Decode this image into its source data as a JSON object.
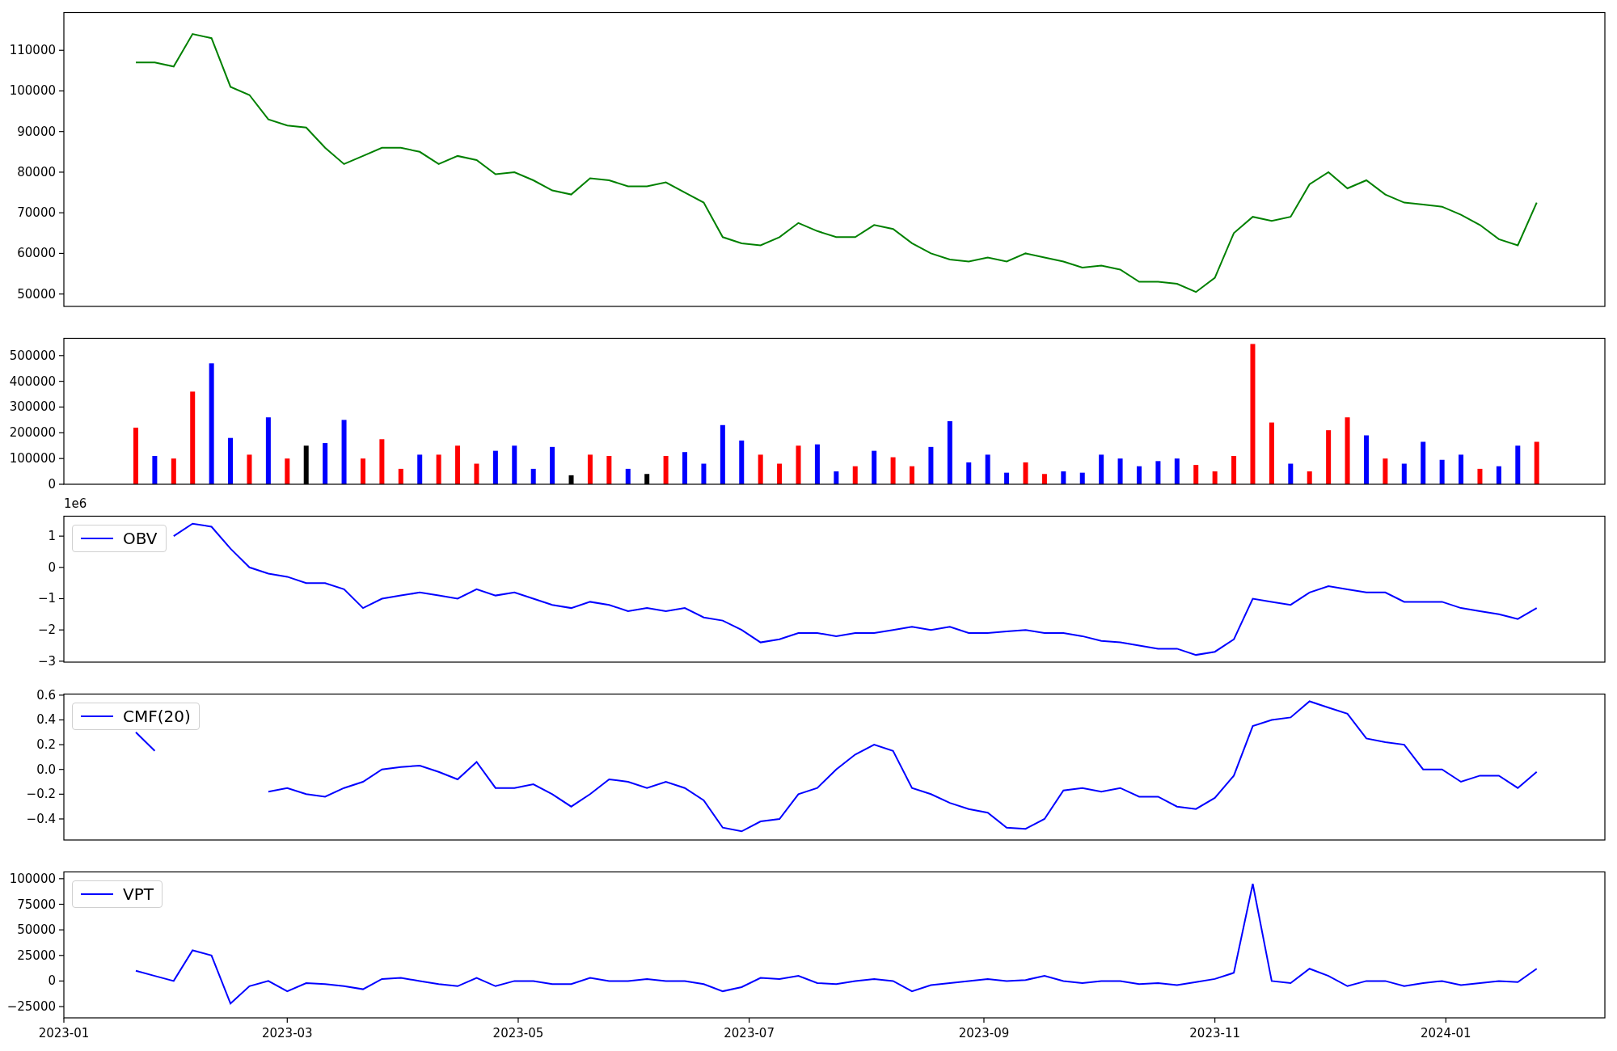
{
  "figure": {
    "panels": [
      {
        "legend": false,
        "chart_data": {
          "type": "line",
          "x": [
            "2023-01-20",
            "2023-01-25",
            "2023-01-30",
            "2023-02-04",
            "2023-02-09",
            "2023-02-14",
            "2023-02-19",
            "2023-02-24",
            "2023-03-01",
            "2023-03-06",
            "2023-03-11",
            "2023-03-16",
            "2023-03-21",
            "2023-03-26",
            "2023-03-31",
            "2023-04-05",
            "2023-04-10",
            "2023-04-15",
            "2023-04-20",
            "2023-04-25",
            "2023-04-30",
            "2023-05-05",
            "2023-05-10",
            "2023-05-15",
            "2023-05-20",
            "2023-05-25",
            "2023-05-30",
            "2023-06-04",
            "2023-06-09",
            "2023-06-14",
            "2023-06-19",
            "2023-06-24",
            "2023-06-29",
            "2023-07-04",
            "2023-07-09",
            "2023-07-14",
            "2023-07-19",
            "2023-07-24",
            "2023-07-29",
            "2023-08-03",
            "2023-08-08",
            "2023-08-13",
            "2023-08-18",
            "2023-08-23",
            "2023-08-28",
            "2023-09-02",
            "2023-09-07",
            "2023-09-12",
            "2023-09-17",
            "2023-09-22",
            "2023-09-27",
            "2023-10-02",
            "2023-10-07",
            "2023-10-12",
            "2023-10-17",
            "2023-10-22",
            "2023-10-27",
            "2023-11-01",
            "2023-11-06",
            "2023-11-11",
            "2023-11-16",
            "2023-11-21",
            "2023-11-26",
            "2023-12-01",
            "2023-12-06",
            "2023-12-11",
            "2023-12-16",
            "2023-12-21",
            "2023-12-26",
            "2023-12-31",
            "2024-01-05",
            "2024-01-10",
            "2024-01-15",
            "2024-01-20",
            "2024-01-25"
          ],
          "series": [
            {
              "color": "#008000",
              "values": [
                107000,
                107000,
                106000,
                114000,
                113000,
                101000,
                99000,
                93000,
                91500,
                91000,
                86000,
                82000,
                84000,
                86000,
                86000,
                85000,
                82000,
                84000,
                83000,
                79500,
                80000,
                78000,
                75500,
                74500,
                78500,
                78000,
                76500,
                76500,
                77500,
                75000,
                72500,
                64000,
                62500,
                62000,
                64000,
                67500,
                65500,
                64000,
                64000,
                67000,
                66000,
                62500,
                60000,
                58500,
                58000,
                59000,
                58000,
                60000,
                59000,
                58000,
                56500,
                57000,
                56000,
                53000,
                53000,
                52500,
                50500,
                54000,
                65000,
                69000,
                68000,
                69000,
                77000,
                80000,
                76000,
                78000,
                74500,
                72500,
                72000,
                71500,
                69500,
                67000,
                63500,
                62000,
                72500
              ]
            }
          ],
          "xlim": [
            "2023-01-01",
            "2024-02-12"
          ],
          "ylim": [
            46950,
            119400
          ],
          "yticks": [
            {
              "value": 50000,
              "label": "50000"
            },
            {
              "value": 60000,
              "label": "60000"
            },
            {
              "value": 70000,
              "label": "70000"
            },
            {
              "value": 80000,
              "label": "80000"
            },
            {
              "value": 90000,
              "label": "90000"
            },
            {
              "value": 100000,
              "label": "100000"
            },
            {
              "value": 110000,
              "label": "110000"
            }
          ]
        }
      },
      {
        "legend": false,
        "chart_data": {
          "type": "bar",
          "x": [
            "2023-01-20",
            "2023-01-25",
            "2023-01-30",
            "2023-02-04",
            "2023-02-09",
            "2023-02-14",
            "2023-02-19",
            "2023-02-24",
            "2023-03-01",
            "2023-03-06",
            "2023-03-11",
            "2023-03-16",
            "2023-03-21",
            "2023-03-26",
            "2023-03-31",
            "2023-04-05",
            "2023-04-10",
            "2023-04-15",
            "2023-04-20",
            "2023-04-25",
            "2023-04-30",
            "2023-05-05",
            "2023-05-10",
            "2023-05-15",
            "2023-05-20",
            "2023-05-25",
            "2023-05-30",
            "2023-06-04",
            "2023-06-09",
            "2023-06-14",
            "2023-06-19",
            "2023-06-24",
            "2023-06-29",
            "2023-07-04",
            "2023-07-09",
            "2023-07-14",
            "2023-07-19",
            "2023-07-24",
            "2023-07-29",
            "2023-08-03",
            "2023-08-08",
            "2023-08-13",
            "2023-08-18",
            "2023-08-23",
            "2023-08-28",
            "2023-09-02",
            "2023-09-07",
            "2023-09-12",
            "2023-09-17",
            "2023-09-22",
            "2023-09-27",
            "2023-10-02",
            "2023-10-07",
            "2023-10-12",
            "2023-10-17",
            "2023-10-22",
            "2023-10-27",
            "2023-11-01",
            "2023-11-06",
            "2023-11-11",
            "2023-11-16",
            "2023-11-21",
            "2023-11-26",
            "2023-12-01",
            "2023-12-06",
            "2023-12-11",
            "2023-12-16",
            "2023-12-21",
            "2023-12-26",
            "2023-12-31",
            "2024-01-05",
            "2024-01-10",
            "2024-01-15",
            "2024-01-20",
            "2024-01-25"
          ],
          "series": [
            {
              "color": "#ff0000",
              "values": [
                220000,
                null,
                100000,
                360000,
                null,
                null,
                115000,
                null,
                100000,
                null,
                null,
                null,
                100000,
                175000,
                60000,
                null,
                115000,
                150000,
                80000,
                null,
                null,
                null,
                null,
                null,
                115000,
                110000,
                null,
                null,
                110000,
                null,
                null,
                null,
                null,
                115000,
                80000,
                150000,
                null,
                null,
                70000,
                null,
                105000,
                70000,
                null,
                null,
                null,
                null,
                null,
                85000,
                40000,
                null,
                null,
                null,
                null,
                null,
                null,
                null,
                75000,
                50000,
                110000,
                545000,
                240000,
                null,
                50000,
                210000,
                260000,
                null,
                100000,
                null,
                null,
                null,
                null,
                60000,
                null,
                null,
                165000
              ]
            },
            {
              "color": "#0000ff",
              "values": [
                null,
                110000,
                null,
                null,
                470000,
                180000,
                null,
                260000,
                null,
                null,
                160000,
                250000,
                null,
                null,
                null,
                115000,
                null,
                null,
                null,
                130000,
                150000,
                60000,
                145000,
                null,
                null,
                null,
                60000,
                null,
                null,
                125000,
                80000,
                230000,
                170000,
                null,
                null,
                null,
                155000,
                50000,
                null,
                130000,
                null,
                null,
                145000,
                245000,
                85000,
                115000,
                45000,
                null,
                null,
                50000,
                45000,
                115000,
                100000,
                70000,
                90000,
                100000,
                null,
                null,
                null,
                null,
                null,
                80000,
                null,
                null,
                null,
                190000,
                null,
                80000,
                165000,
                95000,
                115000,
                null,
                70000,
                150000,
                null
              ]
            },
            {
              "color": "#000000",
              "values": [
                null,
                null,
                null,
                null,
                null,
                null,
                null,
                null,
                null,
                150000,
                null,
                null,
                null,
                null,
                null,
                null,
                null,
                null,
                null,
                null,
                null,
                null,
                null,
                35000,
                null,
                null,
                null,
                40000,
                null,
                null,
                null,
                null,
                null,
                null,
                null,
                null,
                null,
                null,
                null,
                null,
                null,
                null,
                null,
                null,
                null,
                null,
                null,
                null,
                null,
                null,
                null,
                null,
                null,
                null,
                null,
                null,
                null,
                null,
                null,
                null,
                null,
                null,
                null,
                null,
                null,
                null,
                null,
                null,
                null,
                null,
                null,
                null,
                null,
                null,
                null
              ]
            }
          ],
          "xlim": [
            "2023-01-01",
            "2024-02-12"
          ],
          "ylim": [
            0,
            568500
          ],
          "yticks": [
            {
              "value": 0,
              "label": "0"
            },
            {
              "value": 100000,
              "label": "100000"
            },
            {
              "value": 200000,
              "label": "200000"
            },
            {
              "value": 300000,
              "label": "300000"
            },
            {
              "value": 400000,
              "label": "400000"
            },
            {
              "value": 500000,
              "label": "500000"
            }
          ]
        }
      },
      {
        "legend": true,
        "offset_label": "1e6",
        "chart_data": {
          "type": "line",
          "x": [
            "2023-01-30",
            "2023-02-04",
            "2023-02-09",
            "2023-02-14",
            "2023-02-19",
            "2023-02-24",
            "2023-03-01",
            "2023-03-06",
            "2023-03-11",
            "2023-03-16",
            "2023-03-21",
            "2023-03-26",
            "2023-03-31",
            "2023-04-05",
            "2023-04-10",
            "2023-04-15",
            "2023-04-20",
            "2023-04-25",
            "2023-04-30",
            "2023-05-05",
            "2023-05-10",
            "2023-05-15",
            "2023-05-20",
            "2023-05-25",
            "2023-05-30",
            "2023-06-04",
            "2023-06-09",
            "2023-06-14",
            "2023-06-19",
            "2023-06-24",
            "2023-06-29",
            "2023-07-04",
            "2023-07-09",
            "2023-07-14",
            "2023-07-19",
            "2023-07-24",
            "2023-07-29",
            "2023-08-03",
            "2023-08-08",
            "2023-08-13",
            "2023-08-18",
            "2023-08-23",
            "2023-08-28",
            "2023-09-02",
            "2023-09-07",
            "2023-09-12",
            "2023-09-17",
            "2023-09-22",
            "2023-09-27",
            "2023-10-02",
            "2023-10-07",
            "2023-10-12",
            "2023-10-17",
            "2023-10-22",
            "2023-10-27",
            "2023-11-01",
            "2023-11-06",
            "2023-11-11",
            "2023-11-16",
            "2023-11-21",
            "2023-11-26",
            "2023-12-01",
            "2023-12-06",
            "2023-12-11",
            "2023-12-16",
            "2023-12-21",
            "2023-12-26",
            "2023-12-31",
            "2024-01-05",
            "2024-01-10",
            "2024-01-15",
            "2024-01-20",
            "2024-01-25"
          ],
          "series": [
            {
              "name": "OBV",
              "color": "#0000ff",
              "values": [
                1.0,
                1.4,
                1.3,
                0.6,
                0.0,
                -0.2,
                -0.3,
                -0.5,
                -0.5,
                -0.7,
                -1.3,
                -1.0,
                -0.9,
                -0.8,
                -0.9,
                -1.0,
                -0.7,
                -0.9,
                -0.8,
                -1.0,
                -1.2,
                -1.3,
                -1.1,
                -1.2,
                -1.4,
                -1.3,
                -1.4,
                -1.3,
                -1.6,
                -1.7,
                -2.0,
                -2.4,
                -2.3,
                -2.1,
                -2.1,
                -2.2,
                -2.1,
                -2.1,
                -2.0,
                -1.9,
                -2.0,
                -1.9,
                -2.1,
                -2.1,
                -2.05,
                -2.0,
                -2.1,
                -2.1,
                -2.2,
                -2.35,
                -2.4,
                -2.5,
                -2.6,
                -2.6,
                -2.8,
                -2.7,
                -2.3,
                -1.0,
                -1.1,
                -1.2,
                -0.8,
                -0.6,
                -0.7,
                -0.8,
                -0.8,
                -1.1,
                -1.1,
                -1.1,
                -1.3,
                -1.4,
                -1.5,
                -1.65,
                -1.3
              ]
            }
          ],
          "xlim": [
            "2023-01-01",
            "2024-02-12"
          ],
          "ylim": [
            -3.03,
            1.65
          ],
          "yticks": [
            {
              "value": -3,
              "label": "−3"
            },
            {
              "value": -2,
              "label": "−2"
            },
            {
              "value": -1,
              "label": "−1"
            },
            {
              "value": 0,
              "label": "0"
            },
            {
              "value": 1,
              "label": "1"
            }
          ]
        }
      },
      {
        "legend": true,
        "chart_data": {
          "type": "line",
          "x": [
            "2023-01-20",
            "2023-01-25",
            "2023-01-30",
            "2023-02-04",
            "2023-02-09",
            "2023-02-14",
            "2023-02-19",
            "2023-02-24",
            "2023-03-01",
            "2023-03-06",
            "2023-03-11",
            "2023-03-16",
            "2023-03-21",
            "2023-03-26",
            "2023-03-31",
            "2023-04-05",
            "2023-04-10",
            "2023-04-15",
            "2023-04-20",
            "2023-04-25",
            "2023-04-30",
            "2023-05-05",
            "2023-05-10",
            "2023-05-15",
            "2023-05-20",
            "2023-05-25",
            "2023-05-30",
            "2023-06-04",
            "2023-06-09",
            "2023-06-14",
            "2023-06-19",
            "2023-06-24",
            "2023-06-29",
            "2023-07-04",
            "2023-07-09",
            "2023-07-14",
            "2023-07-19",
            "2023-07-24",
            "2023-07-29",
            "2023-08-03",
            "2023-08-08",
            "2023-08-13",
            "2023-08-18",
            "2023-08-23",
            "2023-08-28",
            "2023-09-02",
            "2023-09-07",
            "2023-09-12",
            "2023-09-17",
            "2023-09-22",
            "2023-09-27",
            "2023-10-02",
            "2023-10-07",
            "2023-10-12",
            "2023-10-17",
            "2023-10-22",
            "2023-10-27",
            "2023-11-01",
            "2023-11-06",
            "2023-11-11",
            "2023-11-16",
            "2023-11-21",
            "2023-11-26",
            "2023-12-01",
            "2023-12-06",
            "2023-12-11",
            "2023-12-16",
            "2023-12-21",
            "2023-12-26",
            "2023-12-31",
            "2024-01-05",
            "2024-01-10",
            "2024-01-15",
            "2024-01-20",
            "2024-01-25"
          ],
          "series": [
            {
              "name": "CMF(20)",
              "color": "#0000ff",
              "values": [
                0.3,
                0.15,
                null,
                null,
                null,
                null,
                null,
                -0.18,
                -0.15,
                -0.2,
                -0.22,
                -0.15,
                -0.1,
                0.0,
                0.02,
                0.03,
                -0.02,
                -0.08,
                0.06,
                -0.15,
                -0.15,
                -0.12,
                -0.2,
                -0.3,
                -0.2,
                -0.08,
                -0.1,
                -0.15,
                -0.1,
                -0.15,
                -0.25,
                -0.47,
                -0.5,
                -0.42,
                -0.4,
                -0.2,
                -0.15,
                0.0,
                0.12,
                0.2,
                0.15,
                -0.15,
                -0.2,
                -0.27,
                -0.32,
                -0.35,
                -0.47,
                -0.48,
                -0.4,
                -0.17,
                -0.15,
                -0.18,
                -0.15,
                -0.22,
                -0.22,
                -0.3,
                -0.32,
                -0.23,
                -0.05,
                0.35,
                0.4,
                0.42,
                0.55,
                0.5,
                0.45,
                0.25,
                0.22,
                0.2,
                0.0,
                0.0,
                -0.1,
                -0.05,
                -0.05,
                -0.15,
                -0.02
              ]
            }
          ],
          "xlim": [
            "2023-01-01",
            "2024-02-12"
          ],
          "ylim": [
            -0.57,
            0.612
          ],
          "yticks": [
            {
              "value": -0.4,
              "label": "−0.4"
            },
            {
              "value": -0.2,
              "label": "−0.2"
            },
            {
              "value": 0,
              "label": "0.0"
            },
            {
              "value": 0.2,
              "label": "0.2"
            },
            {
              "value": 0.4,
              "label": "0.4"
            },
            {
              "value": 0.6,
              "label": "0.6"
            }
          ]
        }
      },
      {
        "legend": true,
        "chart_data": {
          "type": "line",
          "x": [
            "2023-01-20",
            "2023-01-25",
            "2023-01-30",
            "2023-02-04",
            "2023-02-09",
            "2023-02-14",
            "2023-02-19",
            "2023-02-24",
            "2023-03-01",
            "2023-03-06",
            "2023-03-11",
            "2023-03-16",
            "2023-03-21",
            "2023-03-26",
            "2023-03-31",
            "2023-04-05",
            "2023-04-10",
            "2023-04-15",
            "2023-04-20",
            "2023-04-25",
            "2023-04-30",
            "2023-05-05",
            "2023-05-10",
            "2023-05-15",
            "2023-05-20",
            "2023-05-25",
            "2023-05-30",
            "2023-06-04",
            "2023-06-09",
            "2023-06-14",
            "2023-06-19",
            "2023-06-24",
            "2023-06-29",
            "2023-07-04",
            "2023-07-09",
            "2023-07-14",
            "2023-07-19",
            "2023-07-24",
            "2023-07-29",
            "2023-08-03",
            "2023-08-08",
            "2023-08-13",
            "2023-08-18",
            "2023-08-23",
            "2023-08-28",
            "2023-09-02",
            "2023-09-07",
            "2023-09-12",
            "2023-09-17",
            "2023-09-22",
            "2023-09-27",
            "2023-10-02",
            "2023-10-07",
            "2023-10-12",
            "2023-10-17",
            "2023-10-22",
            "2023-10-27",
            "2023-11-01",
            "2023-11-06",
            "2023-11-11",
            "2023-11-16",
            "2023-11-21",
            "2023-11-26",
            "2023-12-01",
            "2023-12-06",
            "2023-12-11",
            "2023-12-16",
            "2023-12-21",
            "2023-12-26",
            "2023-12-31",
            "2024-01-05",
            "2024-01-10",
            "2024-01-15",
            "2024-01-20",
            "2024-01-25"
          ],
          "series": [
            {
              "name": "VPT",
              "color": "#0000ff",
              "values": [
                10000,
                5000,
                0,
                30000,
                25000,
                -22000,
                -5000,
                0,
                -10000,
                -2000,
                -3000,
                -5000,
                -8000,
                2000,
                3000,
                0,
                -3000,
                -5000,
                3000,
                -5000,
                0,
                0,
                -3000,
                -3000,
                3000,
                0,
                0,
                2000,
                0,
                0,
                -3000,
                -10000,
                -6000,
                3000,
                2000,
                5000,
                -2000,
                -3000,
                0,
                2000,
                0,
                -10000,
                -4000,
                -2000,
                0,
                2000,
                0,
                1000,
                5000,
                0,
                -2000,
                0,
                0,
                -3000,
                -2000,
                -4000,
                -1000,
                2000,
                8000,
                95000,
                0,
                -2000,
                12000,
                5000,
                -5000,
                0,
                0,
                -5000,
                -2000,
                0,
                -4000,
                -2000,
                0,
                -1000,
                12000
              ]
            }
          ],
          "xlim": [
            "2023-01-01",
            "2024-02-12"
          ],
          "ylim": [
            -36000,
            107000
          ],
          "xticks": [
            {
              "value": "2023-01-01",
              "label": "2023-01"
            },
            {
              "value": "2023-03-01",
              "label": "2023-03"
            },
            {
              "value": "2023-05-01",
              "label": "2023-05"
            },
            {
              "value": "2023-07-01",
              "label": "2023-07"
            },
            {
              "value": "2023-09-01",
              "label": "2023-09"
            },
            {
              "value": "2023-11-01",
              "label": "2023-11"
            },
            {
              "value": "2024-01-01",
              "label": "2024-01"
            }
          ],
          "yticks": [
            {
              "value": -25000,
              "label": "−25000"
            },
            {
              "value": 0,
              "label": "0"
            },
            {
              "value": 25000,
              "label": "25000"
            },
            {
              "value": 50000,
              "label": "50000"
            },
            {
              "value": 75000,
              "label": "75000"
            },
            {
              "value": 100000,
              "label": "100000"
            }
          ]
        }
      }
    ]
  }
}
